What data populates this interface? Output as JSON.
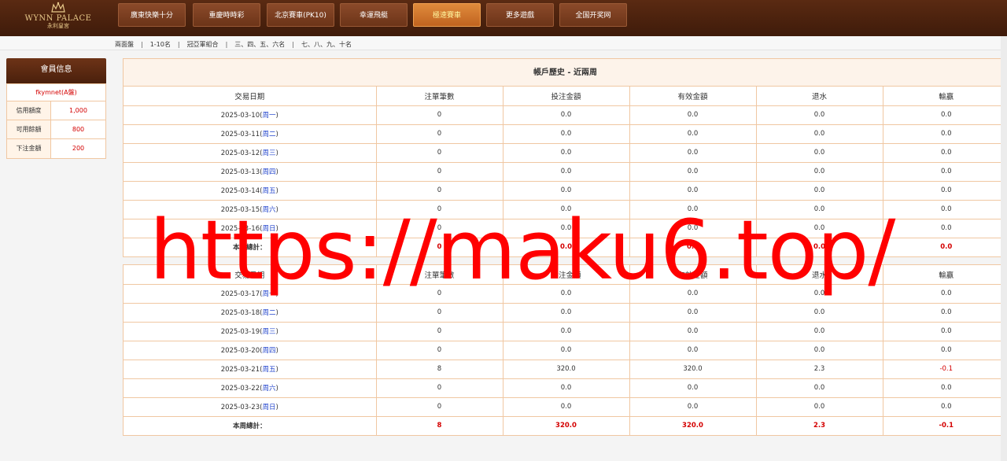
{
  "logo": {
    "en": "WYNN PALACE",
    "cn": "永利皇宮"
  },
  "nav": [
    {
      "label": "廣東快樂十分",
      "active": false
    },
    {
      "label": "重慶時時彩",
      "active": false
    },
    {
      "label": "北京賽車(PK10)",
      "active": false
    },
    {
      "label": "幸運飛艇",
      "active": false
    },
    {
      "label": "極速賽車",
      "active": true
    },
    {
      "label": "更多遊戲",
      "active": false
    },
    {
      "label": "全国开奖网",
      "active": false
    }
  ],
  "subnav": [
    "兩面盤",
    "1-10名",
    "冠亞軍組合",
    "三、四、五、六名",
    "七、八、九、十名"
  ],
  "sidebar": {
    "title": "會員信息",
    "user": "fkymnet(A盤)",
    "rows": [
      {
        "k": "信用額度",
        "v": "1,000"
      },
      {
        "k": "可用餘額",
        "v": "800"
      },
      {
        "k": "下注金額",
        "v": "200"
      }
    ]
  },
  "history": {
    "title": "帳戶歷史 - 近兩周",
    "headers": [
      "交易日期",
      "注單筆數",
      "投注金額",
      "有效金額",
      "退水",
      "輸贏"
    ],
    "weeks": [
      {
        "rows": [
          {
            "date": "2025-03-10",
            "wd": "周一",
            "n": "0",
            "bet": "0.0",
            "valid": "0.0",
            "rebate": "0.0",
            "win": "0.0"
          },
          {
            "date": "2025-03-11",
            "wd": "周二",
            "n": "0",
            "bet": "0.0",
            "valid": "0.0",
            "rebate": "0.0",
            "win": "0.0"
          },
          {
            "date": "2025-03-12",
            "wd": "周三",
            "n": "0",
            "bet": "0.0",
            "valid": "0.0",
            "rebate": "0.0",
            "win": "0.0"
          },
          {
            "date": "2025-03-13",
            "wd": "周四",
            "n": "0",
            "bet": "0.0",
            "valid": "0.0",
            "rebate": "0.0",
            "win": "0.0"
          },
          {
            "date": "2025-03-14",
            "wd": "周五",
            "n": "0",
            "bet": "0.0",
            "valid": "0.0",
            "rebate": "0.0",
            "win": "0.0"
          },
          {
            "date": "2025-03-15",
            "wd": "周六",
            "n": "0",
            "bet": "0.0",
            "valid": "0.0",
            "rebate": "0.0",
            "win": "0.0"
          },
          {
            "date": "2025-03-16",
            "wd": "周日",
            "n": "0",
            "bet": "0.0",
            "valid": "0.0",
            "rebate": "0.0",
            "win": "0.0"
          }
        ],
        "total": {
          "label": "本周總計：",
          "n": "0",
          "bet": "0.0",
          "valid": "0.0",
          "rebate": "0.0",
          "win": "0.0"
        }
      },
      {
        "rows": [
          {
            "date": "2025-03-17",
            "wd": "周一",
            "n": "0",
            "bet": "0.0",
            "valid": "0.0",
            "rebate": "0.0",
            "win": "0.0"
          },
          {
            "date": "2025-03-18",
            "wd": "周二",
            "n": "0",
            "bet": "0.0",
            "valid": "0.0",
            "rebate": "0.0",
            "win": "0.0"
          },
          {
            "date": "2025-03-19",
            "wd": "周三",
            "n": "0",
            "bet": "0.0",
            "valid": "0.0",
            "rebate": "0.0",
            "win": "0.0"
          },
          {
            "date": "2025-03-20",
            "wd": "周四",
            "n": "0",
            "bet": "0.0",
            "valid": "0.0",
            "rebate": "0.0",
            "win": "0.0"
          },
          {
            "date": "2025-03-21",
            "wd": "周五",
            "n": "8",
            "bet": "320.0",
            "valid": "320.0",
            "rebate": "2.3",
            "win": "-0.1"
          },
          {
            "date": "2025-03-22",
            "wd": "周六",
            "n": "0",
            "bet": "0.0",
            "valid": "0.0",
            "rebate": "0.0",
            "win": "0.0"
          },
          {
            "date": "2025-03-23",
            "wd": "周日",
            "n": "0",
            "bet": "0.0",
            "valid": "0.0",
            "rebate": "0.0",
            "win": "0.0"
          }
        ],
        "total": {
          "label": "本周總計：",
          "n": "8",
          "bet": "320.0",
          "valid": "320.0",
          "rebate": "2.3",
          "win": "-0.1"
        }
      }
    ]
  },
  "watermark": "https://maku6.top/"
}
